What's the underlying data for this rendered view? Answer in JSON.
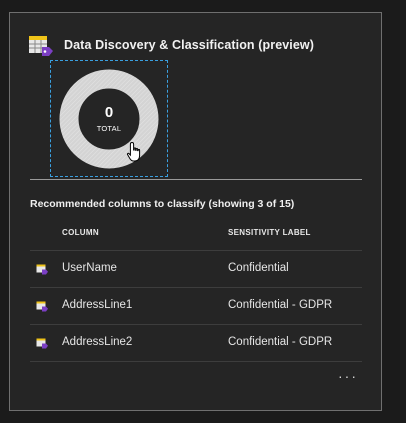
{
  "tile": {
    "title": "Data Discovery & Classification (preview)",
    "icon": "data-classification-icon"
  },
  "donut": {
    "value": "0",
    "caption": "TOTAL",
    "ring_color": "#d9d9d9",
    "hole_color": "#252525"
  },
  "recommended": {
    "title": "Recommended columns to classify (showing 3 of 15)",
    "headers": {
      "column": "COLUMN",
      "sensitivity_label": "SENSITIVITY LABEL"
    },
    "rows": [
      {
        "icon": "column-icon",
        "column": "UserName",
        "label": "Confidential"
      },
      {
        "icon": "column-icon",
        "column": "AddressLine1",
        "label": "Confidential - GDPR"
      },
      {
        "icon": "column-icon",
        "column": "AddressLine2",
        "label": "Confidential - GDPR"
      }
    ]
  },
  "more": {
    "label": "···"
  },
  "colors": {
    "focus_outline": "#3aa0e0",
    "tile_border": "#6f6f6f",
    "icon_purple": "#7b3fc4",
    "icon_yellow": "#f0c419"
  }
}
